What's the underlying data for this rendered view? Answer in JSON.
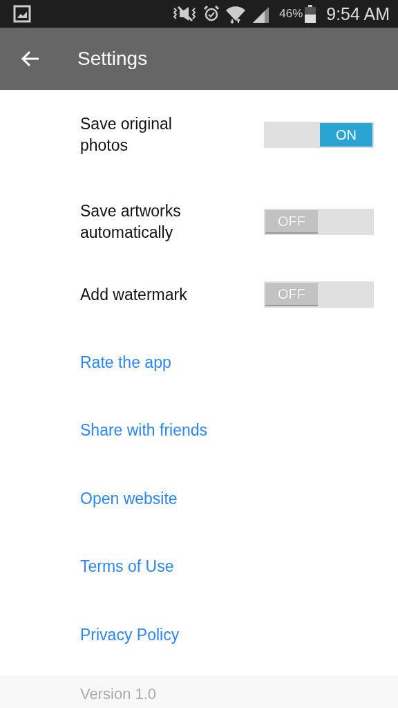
{
  "status_bar": {
    "battery": "46%",
    "time": "9:54 AM"
  },
  "toolbar": {
    "title": "Settings"
  },
  "toggles": [
    {
      "label": "Save original photos",
      "on": true,
      "text": "ON"
    },
    {
      "label": "Save artworks automatically",
      "on": false,
      "text": "OFF"
    },
    {
      "label": "Add watermark",
      "on": false,
      "text": "OFF"
    }
  ],
  "links": [
    "Rate the app",
    "Share with friends",
    "Open website",
    "Terms of Use",
    "Privacy Policy"
  ],
  "footer": {
    "version": "Version 1.0"
  }
}
